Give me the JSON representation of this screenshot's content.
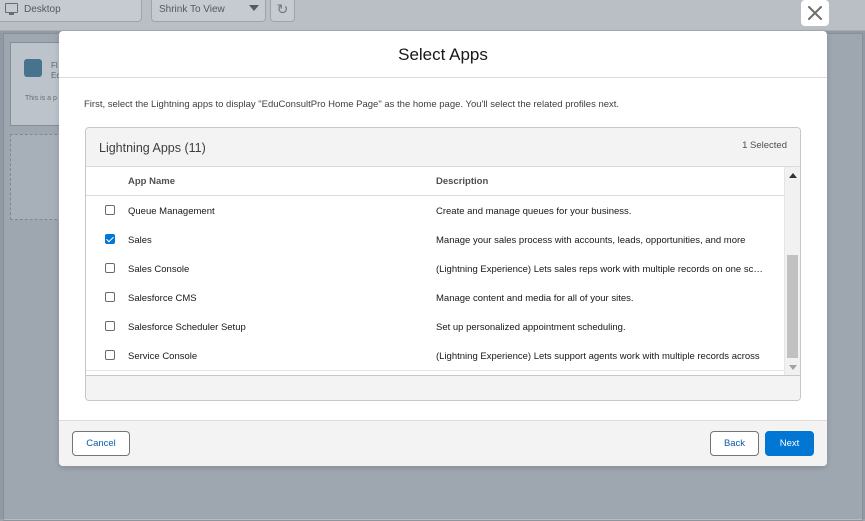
{
  "background": {
    "view_button": "Desktop",
    "zoom_select": "Shrink To View",
    "card_title_fragment": "Fl",
    "card_subtitle_fragment": "Ec",
    "card_text_fragment": "This is a p"
  },
  "modal": {
    "title": "Select Apps",
    "instructions": "First, select the Lightning apps to display \"EduConsultPro Home Page\" as the home page. You'll select the related profiles next.",
    "card": {
      "title": "Lightning Apps (11)",
      "selected_count": "1 Selected",
      "columns": {
        "name": "App Name",
        "description": "Description"
      },
      "rows": [
        {
          "name": "Queue Management",
          "description": "Create and manage queues for your business.",
          "checked": false
        },
        {
          "name": "Sales",
          "description": "Manage your sales process with accounts, leads, opportunities, and more",
          "checked": true
        },
        {
          "name": "Sales Console",
          "description": "(Lightning Experience) Lets sales reps work with multiple records on one screen",
          "checked": false
        },
        {
          "name": "Salesforce CMS",
          "description": "Manage content and media for all of your sites.",
          "checked": false
        },
        {
          "name": "Salesforce Scheduler Setup",
          "description": "Set up personalized appointment scheduling.",
          "checked": false
        },
        {
          "name": "Service Console",
          "description": "(Lightning Experience) Lets support agents work with multiple records across",
          "checked": false
        }
      ]
    },
    "footer": {
      "cancel": "Cancel",
      "back": "Back",
      "next": "Next"
    }
  },
  "colors": {
    "brand": "#0176d3",
    "link": "#0b5cab"
  }
}
